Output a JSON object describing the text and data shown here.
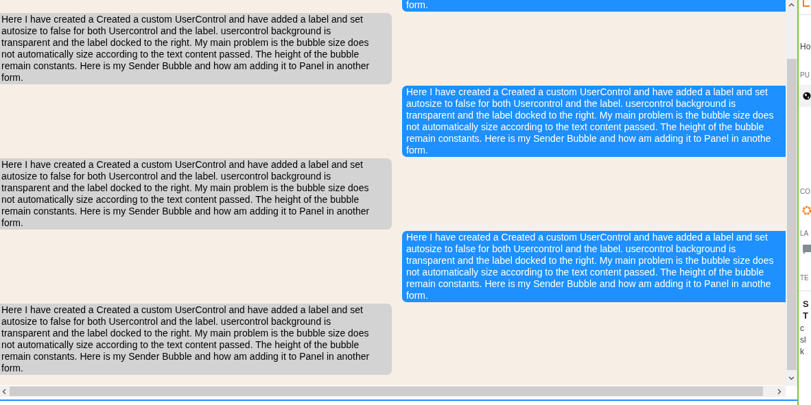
{
  "messages": [
    {
      "kind": "sent",
      "text": "form."
    },
    {
      "kind": "received",
      "text": "Here I have created a Created a custom UserControl and have added a label and set\nautosize to false for both Usercontrol and the label. usercontrol background is\ntransparent and the label docked to the right. My main problem is the bubble size does\nnot automatically size according to the text content passed. The height of the bubble\nremain constants. Here is my Sender Bubble and how am adding it to Panel in another\nform."
    },
    {
      "kind": "sent",
      "text": "Here I have created a Created a custom UserControl and have added a label and set\nautosize to false for both Usercontrol and the label. usercontrol background is\ntransparent and the label docked to the right. My main problem is the bubble size does\nnot automatically size according to the text content passed. The height of the bubble\nremain constants. Here is my Sender Bubble and how am adding it to Panel in anothe\nform."
    },
    {
      "kind": "received",
      "text": "Here I have created a Created a custom UserControl and have added a label and set\nautosize to false for both Usercontrol and the label. usercontrol background is\ntransparent and the label docked to the right. My main problem is the bubble size does\nnot automatically size according to the text content passed. The height of the bubble\nremain constants. Here is my Sender Bubble and how am adding it to Panel in another\nform."
    },
    {
      "kind": "sent",
      "text": "Here I have created a Created a custom UserControl and have added a label and set\nautosize to false for both Usercontrol and the label. usercontrol background is\ntransparent and the label docked to the right. My main problem is the bubble size does\nnot automatically size according to the text content passed. The height of the bubble\nremain constants. Here is my Sender Bubble and how am adding it to Panel in anothe\nform."
    },
    {
      "kind": "received",
      "text": "Here I have created a Created a custom UserControl and have added a label and set\nautosize to false for both Usercontrol and the label. usercontrol background is\ntransparent and the label docked to the right. My main problem is the bubble size does\nnot automatically size according to the text content passed. The height of the bubble\nremain constants. Here is my Sender Bubble and how am adding it to Panel in another\nform."
    }
  ],
  "sidebar": {
    "items": [
      {
        "kind": "text",
        "text": "Ho"
      },
      {
        "kind": "heading",
        "text": "PU"
      },
      {
        "kind": "globe"
      },
      {
        "kind": "heading",
        "text": "CO"
      },
      {
        "kind": "badge"
      },
      {
        "kind": "heading",
        "text": "LA"
      },
      {
        "kind": "comment"
      },
      {
        "kind": "heading",
        "text": "TE"
      },
      {
        "kind": "title",
        "text": "S\nT"
      },
      {
        "kind": "text",
        "text": "c\nsl\nk"
      }
    ]
  }
}
